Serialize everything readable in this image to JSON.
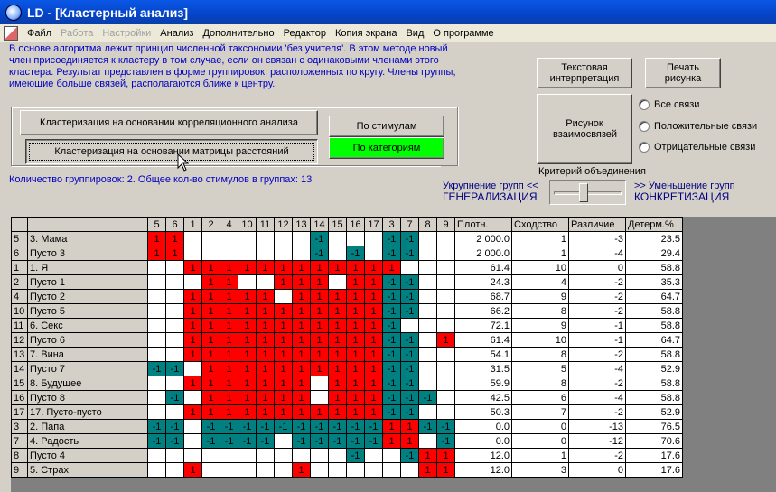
{
  "window": {
    "title": "LD  - [Кластерный анализ]"
  },
  "menu": [
    "Файл",
    "Работа",
    "Настройки",
    "Анализ",
    "Дополнительно",
    "Редактор",
    "Копия экрана",
    "Вид",
    "О программе"
  ],
  "menu_disabled": [
    "Работа",
    "Настройки"
  ],
  "description": "В основе алгоритма лежит принцип численной таксономии 'без учителя'. В этом методе новый член присоединяется к кластеру в том случае, если он связан с одинаковыми членами этого кластера. Результат представлен в форме группировок, расположенных по кругу. Члены группы, имеющие больше связей, располагаются ближе к центру.",
  "buttons": {
    "text_interp": "Текстовая интерпретация",
    "print_fig": "Печать рисунка",
    "fig_links": "Рисунок взаимосвязей",
    "cluster_corr": "Кластеризация на основании корреляционного анализа",
    "cluster_dist": "Кластеризация на основании матрицы расстояний",
    "by_stimuli": "По стимулам",
    "by_categories": "По категориям"
  },
  "radios": [
    "Все связи",
    "Положительные связи",
    "Отрицательные связи"
  ],
  "summary": "Количество группировок:  2.  Общее кол-во стимулов в группах:  13",
  "criterion": {
    "title": "Критерий объединения",
    "left1": "Укрупнение групп <<",
    "left2": "ГЕНЕРАЛИЗАЦИЯ",
    "right1": ">> Уменьшение групп",
    "right2": "КОНКРЕТИЗАЦИЯ",
    "level": 0.42
  },
  "colors": {
    "red": "#ff0000",
    "teal": "#008080",
    "text_blue": "#0000c0"
  },
  "table": {
    "col_headers": [
      "5",
      "6",
      "1",
      "2",
      "4",
      "10",
      "11",
      "12",
      "13",
      "14",
      "15",
      "16",
      "17",
      "3",
      "7",
      "8",
      "9"
    ],
    "stat_headers": [
      "Плотн.",
      "Сходство",
      "Различие",
      "Детерм.%"
    ],
    "rows": [
      {
        "num": "5",
        "name": "3. Мама",
        "cells": "RR.......T...TT..",
        "vals": [
          "2 000.0",
          "1",
          "-3",
          "23.5"
        ]
      },
      {
        "num": "6",
        "name": "Пусто 3",
        "cells": "RR.......T.T.TT..",
        "vals": [
          "2 000.0",
          "1",
          "-4",
          "29.4"
        ]
      },
      {
        "num": "1",
        "name": "1. Я",
        "cells": "..RRRRRRRRRRRR...",
        "vals": [
          "61.4",
          "10",
          "0",
          "58.8"
        ]
      },
      {
        "num": "2",
        "name": "Пусто 1",
        "cells": "...RR..RRR.RRTT..",
        "vals": [
          "24.3",
          "4",
          "-2",
          "35.3"
        ]
      },
      {
        "num": "4",
        "name": "Пусто 2",
        "cells": "..RRRRR.RRRRRTT..",
        "vals": [
          "68.7",
          "9",
          "-2",
          "64.7"
        ]
      },
      {
        "num": "10",
        "name": "Пусто 5",
        "cells": "..RRRRRRRRRRRTT..",
        "vals": [
          "66.2",
          "8",
          "-2",
          "58.8"
        ]
      },
      {
        "num": "11",
        "name": "6. Секс",
        "cells": "..RRRRRRRRRRRT...",
        "vals": [
          "72.1",
          "9",
          "-1",
          "58.8"
        ]
      },
      {
        "num": "12",
        "name": "Пусто 6",
        "cells": "..RRRRRRRRRRRTT.R",
        "vals": [
          "61.4",
          "10",
          "-1",
          "64.7"
        ]
      },
      {
        "num": "13",
        "name": "7. Вина",
        "cells": "..RRRRRRRRRRRTT..",
        "vals": [
          "54.1",
          "8",
          "-2",
          "58.8"
        ]
      },
      {
        "num": "14",
        "name": "Пусто 7",
        "cells": "TT.RRRRRRRRRRTT..",
        "vals": [
          "31.5",
          "5",
          "-4",
          "52.9"
        ]
      },
      {
        "num": "15",
        "name": "8. Будущее",
        "cells": "..RRRRRRR.RRRTT..",
        "vals": [
          "59.9",
          "8",
          "-2",
          "58.8"
        ]
      },
      {
        "num": "16",
        "name": "Пусто 8",
        "cells": ".T.RRRRRR.RRRTTT.",
        "vals": [
          "42.5",
          "6",
          "-4",
          "58.8"
        ]
      },
      {
        "num": "17",
        "name": "17. Пусто-пусто",
        "cells": "..RRRRRRRRRRRTT..",
        "vals": [
          "50.3",
          "7",
          "-2",
          "52.9"
        ]
      },
      {
        "num": "3",
        "name": "2. Папа",
        "cells": "TT.TTTTTTTTTTRRTT",
        "vals": [
          "0.0",
          "0",
          "-13",
          "76.5"
        ]
      },
      {
        "num": "7",
        "name": "4. Радость",
        "cells": "TT.TTTT.TTTTTRR.T",
        "vals": [
          "0.0",
          "0",
          "-12",
          "70.6"
        ]
      },
      {
        "num": "8",
        "name": "Пусто 4",
        "cells": "...........T..TRR",
        "vals": [
          "12.0",
          "1",
          "-2",
          "17.6"
        ]
      },
      {
        "num": "9",
        "name": "5. Страх",
        "cells": "..R.....R......RR",
        "vals": [
          "12.0",
          "3",
          "0",
          "17.6"
        ]
      }
    ]
  }
}
